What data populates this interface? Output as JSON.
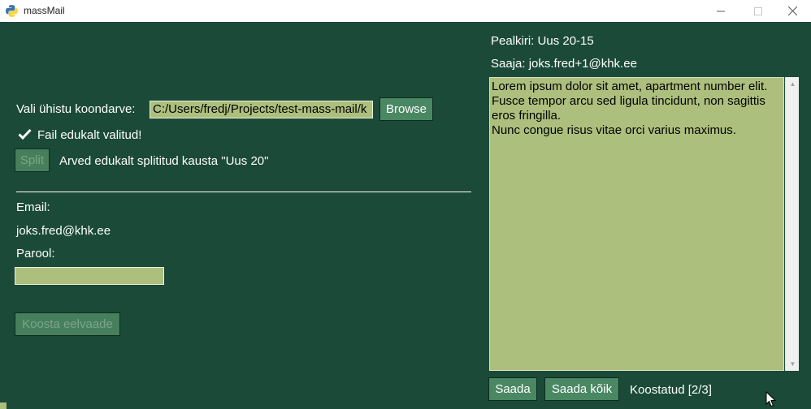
{
  "window": {
    "title": "massMail"
  },
  "left": {
    "invoice_label": "Vali ühistu koondarve:",
    "invoice_path": "C:/Users/fredj/Projects/test-mass-mail/k",
    "browse_label": "Browse",
    "file_ok_text": "Fail edukalt valitud!",
    "split_label": "Split",
    "split_status": "Arved edukalt splititud kausta \"Uus 20\"",
    "email_label": "Email:",
    "email_value": "joks.fred@khk.ee",
    "password_label": "Parool:",
    "password_value": "",
    "preview_label": "Koosta eelvaade"
  },
  "right": {
    "subject_text": "Pealkiri: Uus 20-15",
    "recipient_text": "Saaja: joks.fred+1@khk.ee",
    "body_text": "Lorem ipsum dolor sit amet, apartment number elit.\nFusce tempor arcu sed ligula tincidunt, non sagittis eros fringilla.\nNunc congue risus vitae orci varius maximus.",
    "send_label": "Saada",
    "send_all_label": "Saada kõik",
    "compiled_status": "Koostatud [2/3]"
  },
  "colors": {
    "background": "#1b4a38",
    "entry": "#adbf7d",
    "button": "#4a8763"
  }
}
